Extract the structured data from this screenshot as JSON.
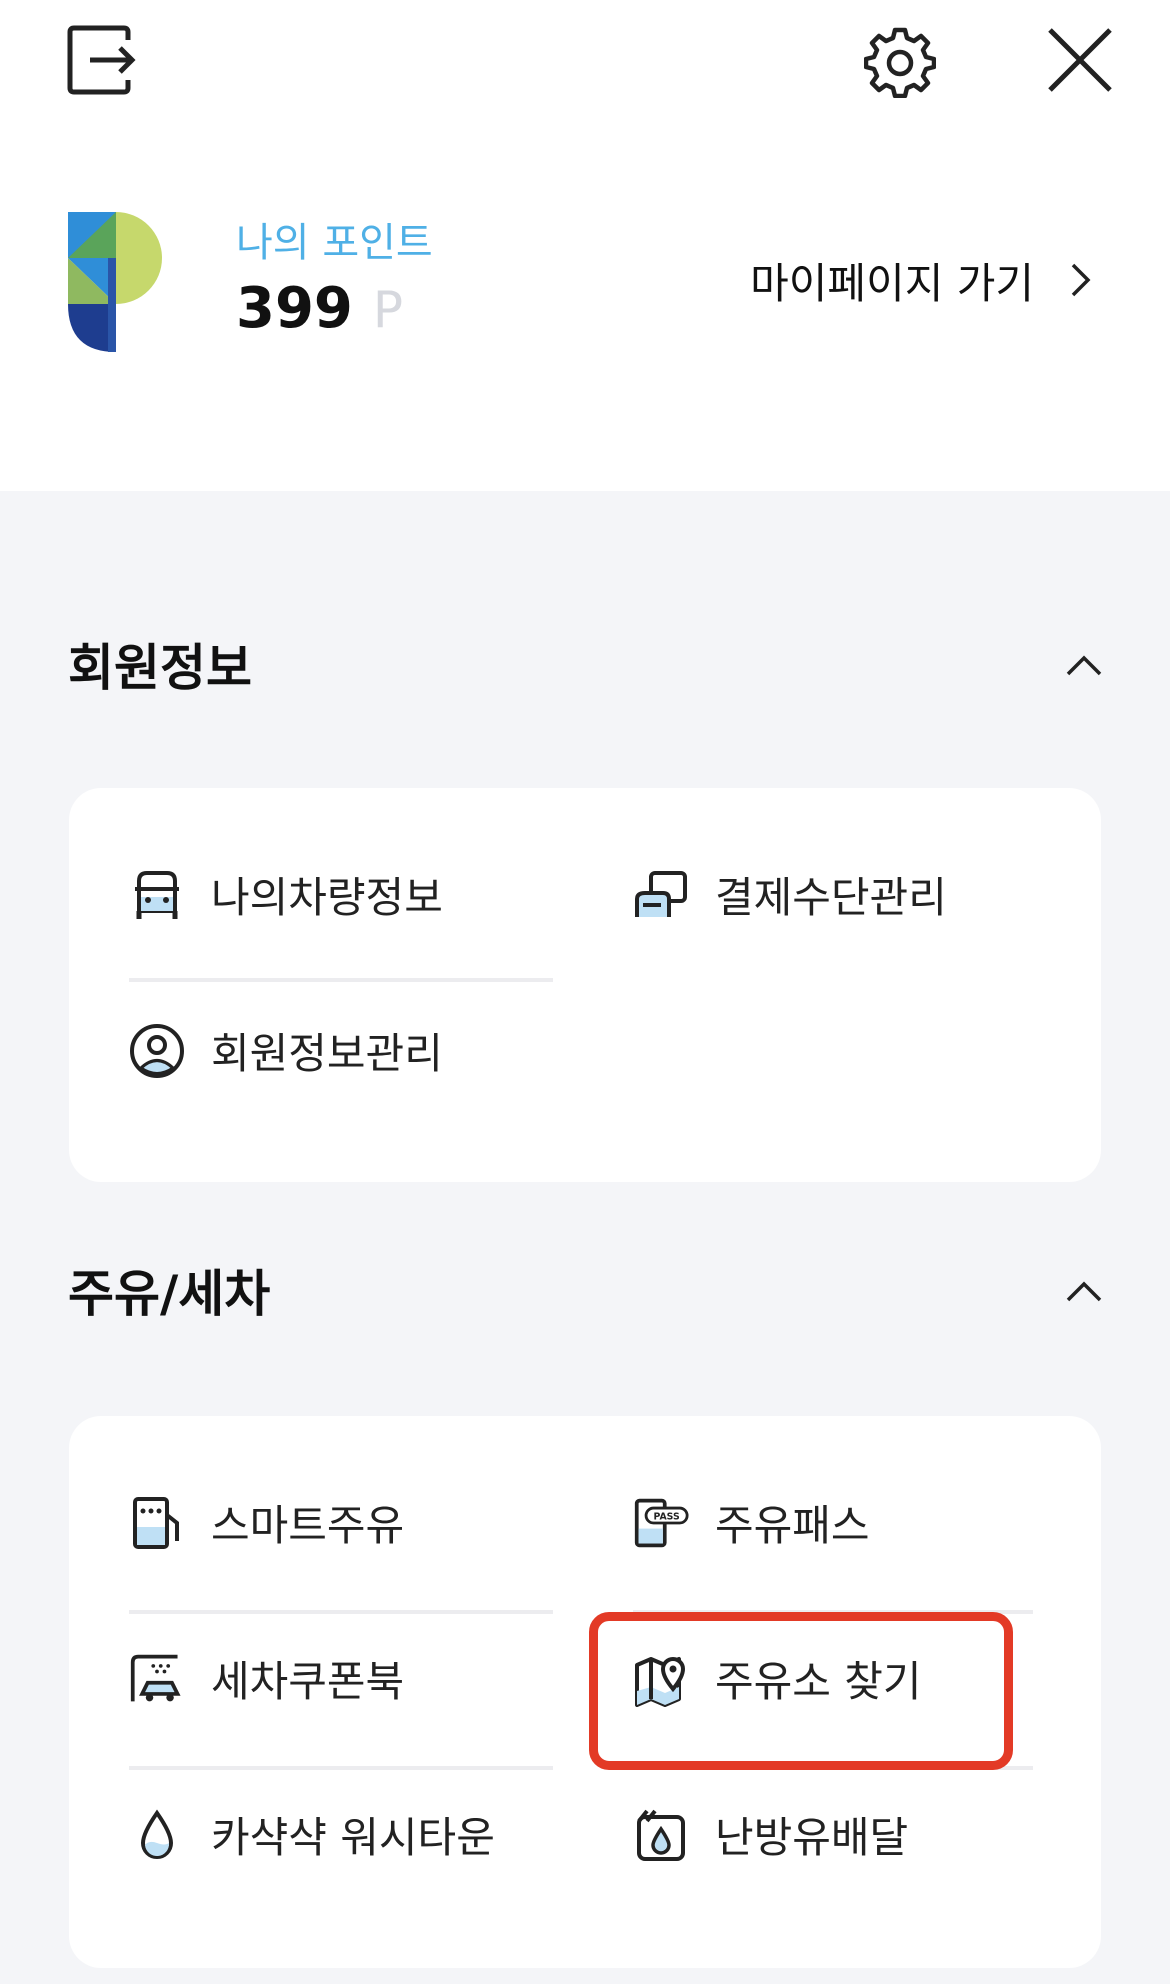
{
  "header": {
    "logout_icon": "logout-icon",
    "settings_icon": "gear-icon",
    "close_icon": "close-icon"
  },
  "points": {
    "label": "나의 포인트",
    "value": "399",
    "unit": "P",
    "mypage_link": "마이페이지 가기"
  },
  "sections": {
    "member": {
      "title": "회원정보",
      "items": [
        {
          "label": "나의차량정보",
          "icon": "car-icon"
        },
        {
          "label": "결제수단관리",
          "icon": "card-icon"
        },
        {
          "label": "회원정보관리",
          "icon": "user-icon"
        }
      ]
    },
    "fuel": {
      "title": "주유/세차",
      "items": [
        {
          "label": "스마트주유",
          "icon": "fuel-pump-icon"
        },
        {
          "label": "주유패스",
          "icon": "fuel-pass-icon",
          "badge": "PASS"
        },
        {
          "label": "세차쿠폰북",
          "icon": "car-wash-icon"
        },
        {
          "label": "주유소 찾기",
          "icon": "map-pin-icon"
        },
        {
          "label": "카샥샥 워시타운",
          "icon": "water-drop-icon"
        },
        {
          "label": "난방유배달",
          "icon": "oil-can-icon"
        }
      ]
    }
  },
  "colors": {
    "accent_blue": "#4fb0e6",
    "highlight_red": "#e33a26",
    "background": "#f4f5f8"
  }
}
